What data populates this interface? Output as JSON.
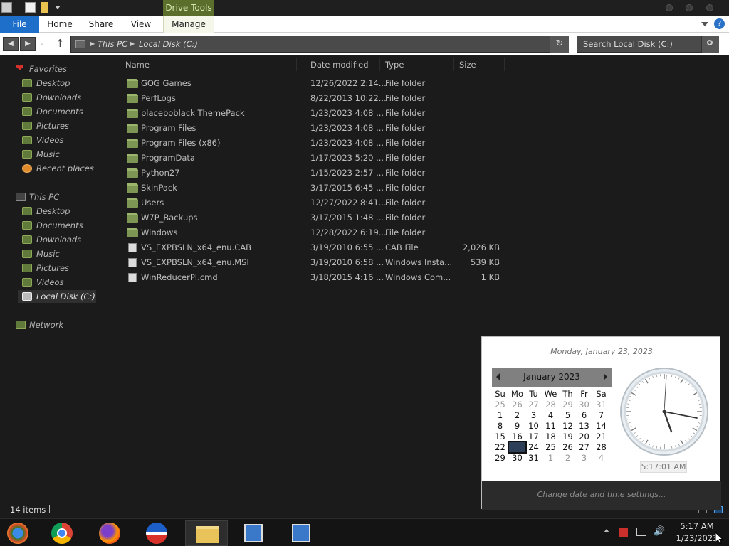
{
  "ribbon": {
    "contextual_group": "Drive Tools",
    "tabs": [
      "File",
      "Home",
      "Share",
      "View",
      "Manage"
    ]
  },
  "address": {
    "breadcrumb": [
      "This PC",
      "Local Disk (C:)"
    ],
    "search_placeholder": "Search Local Disk (C:)"
  },
  "nav": {
    "favorites": {
      "label": "Favorites",
      "items": [
        "Desktop",
        "Downloads",
        "Documents",
        "Pictures",
        "Videos",
        "Music",
        "Recent places"
      ]
    },
    "this_pc": {
      "label": "This PC",
      "items": [
        "Desktop",
        "Documents",
        "Downloads",
        "Music",
        "Pictures",
        "Videos",
        "Local Disk (C:)"
      ]
    },
    "network": {
      "label": "Network"
    }
  },
  "columns": {
    "name": "Name",
    "date": "Date modified",
    "type": "Type",
    "size": "Size"
  },
  "files": [
    {
      "name": "GOG Games",
      "date": "12/26/2022 2:14...",
      "type": "File folder",
      "size": "",
      "icon": "folder-icon"
    },
    {
      "name": "PerfLogs",
      "date": "8/22/2013 10:22...",
      "type": "File folder",
      "size": "",
      "icon": "folder-icon"
    },
    {
      "name": "placeboblack ThemePack",
      "date": "1/23/2023 4:08 ...",
      "type": "File folder",
      "size": "",
      "icon": "folder-icon"
    },
    {
      "name": "Program Files",
      "date": "1/23/2023 4:08 ...",
      "type": "File folder",
      "size": "",
      "icon": "folder-icon"
    },
    {
      "name": "Program Files (x86)",
      "date": "1/23/2023 4:08 ...",
      "type": "File folder",
      "size": "",
      "icon": "folder-icon"
    },
    {
      "name": "ProgramData",
      "date": "1/17/2023 5:20 ...",
      "type": "File folder",
      "size": "",
      "icon": "folder-icon"
    },
    {
      "name": "Python27",
      "date": "1/15/2023 2:57 ...",
      "type": "File folder",
      "size": "",
      "icon": "folder-icon"
    },
    {
      "name": "SkinPack",
      "date": "3/17/2015 6:45 ...",
      "type": "File folder",
      "size": "",
      "icon": "folder-icon"
    },
    {
      "name": "Users",
      "date": "12/27/2022 8:41...",
      "type": "File folder",
      "size": "",
      "icon": "folder-icon"
    },
    {
      "name": "W7P_Backups",
      "date": "3/17/2015 1:48 ...",
      "type": "File folder",
      "size": "",
      "icon": "folder-icon"
    },
    {
      "name": "Windows",
      "date": "12/28/2022 6:19...",
      "type": "File folder",
      "size": "",
      "icon": "folder-icon"
    },
    {
      "name": "VS_EXPBSLN_x64_enu.CAB",
      "date": "3/19/2010 6:55 ...",
      "type": "CAB File",
      "size": "2,026 KB",
      "icon": "file-icon"
    },
    {
      "name": "VS_EXPBSLN_x64_enu.MSI",
      "date": "3/19/2010 6:58 ...",
      "type": "Windows Insta...",
      "size": "539 KB",
      "icon": "installer-icon"
    },
    {
      "name": "WinReducerPI.cmd",
      "date": "3/18/2015 4:16 ...",
      "type": "Windows Com...",
      "size": "1 KB",
      "icon": "cmd-file-icon"
    }
  ],
  "status": {
    "item_count": "14 items"
  },
  "calendar": {
    "long_date": "Monday, January 23, 2023",
    "month_title": "January 2023",
    "weekdays": [
      "Su",
      "Mo",
      "Tu",
      "We",
      "Th",
      "Fr",
      "Sa"
    ],
    "weeks": [
      [
        "25",
        "26",
        "27",
        "28",
        "29",
        "30",
        "31"
      ],
      [
        "1",
        "2",
        "3",
        "4",
        "5",
        "6",
        "7"
      ],
      [
        "8",
        "9",
        "10",
        "11",
        "12",
        "13",
        "14"
      ],
      [
        "15",
        "16",
        "17",
        "18",
        "19",
        "20",
        "21"
      ],
      [
        "22",
        "23",
        "24",
        "25",
        "26",
        "27",
        "28"
      ],
      [
        "29",
        "30",
        "31",
        "1",
        "2",
        "3",
        "4"
      ]
    ],
    "today": "23",
    "digital_time": "5:17:01 AM",
    "settings_link": "Change date and time settings..."
  },
  "tray": {
    "time": "5:17 AM",
    "date": "1/23/2023"
  },
  "colors": {
    "accent": "#1e6fc9",
    "drive_tools": "#5b6e2c",
    "folder": "#7d9653"
  }
}
